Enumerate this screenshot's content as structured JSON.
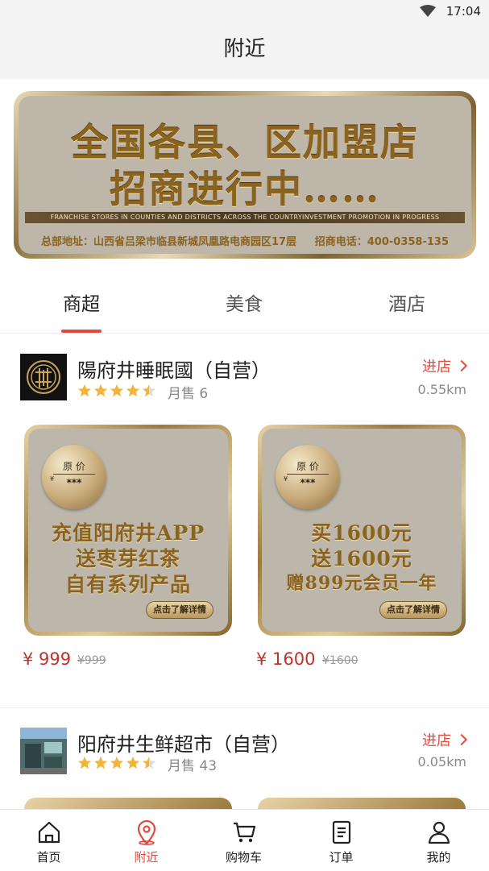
{
  "status_bar": {
    "time": "17:04"
  },
  "header": {
    "title": "附近"
  },
  "banner": {
    "line1": "全国各县、区加盟店",
    "line2": "招商进行中……",
    "strip": "FRANCHISE STORES IN COUNTIES AND DISTRICTS ACROSS THE COUNTRYINVESTMENT PROMOTION IN PROGRESS",
    "address": "总部地址：山西省吕梁市临县新城凤凰路电商园区17层",
    "phone": "招商电话：400-0358-135"
  },
  "tabs": [
    {
      "label": "商超"
    },
    {
      "label": "美食"
    },
    {
      "label": "酒店"
    }
  ],
  "stores": [
    {
      "name": "陽府井睡眠國（自营）",
      "rating": 4.5,
      "sales": "月售 6",
      "enter": "进店",
      "distance": "0.55km",
      "products": [
        {
          "coin_top": "原 价",
          "coin_bottom": "***",
          "lines": [
            "充值阳府井APP",
            "送枣芽红茶",
            "自有系列产品"
          ],
          "button": "点击了解详情",
          "price": "¥ 999",
          "original_price": "¥999"
        },
        {
          "coin_top": "原 价",
          "coin_bottom": "***",
          "lines": [
            "买1600元",
            "送1600元",
            "赠899元会员一年"
          ],
          "button": "点击了解详情",
          "price": "¥ 1600",
          "original_price": "¥1600"
        }
      ]
    },
    {
      "name": "阳府井生鲜超市（自营）",
      "rating": 4.5,
      "sales": "月售 43",
      "enter": "进店",
      "distance": "0.05km"
    }
  ],
  "bottom_nav": [
    {
      "label": "首页",
      "icon": "home-icon"
    },
    {
      "label": "附近",
      "icon": "location-pin-icon"
    },
    {
      "label": "购物车",
      "icon": "cart-icon"
    },
    {
      "label": "订单",
      "icon": "order-list-icon"
    },
    {
      "label": "我的",
      "icon": "user-icon"
    }
  ],
  "colors": {
    "accent": "#e04a3f",
    "gold": "#8a6320"
  }
}
